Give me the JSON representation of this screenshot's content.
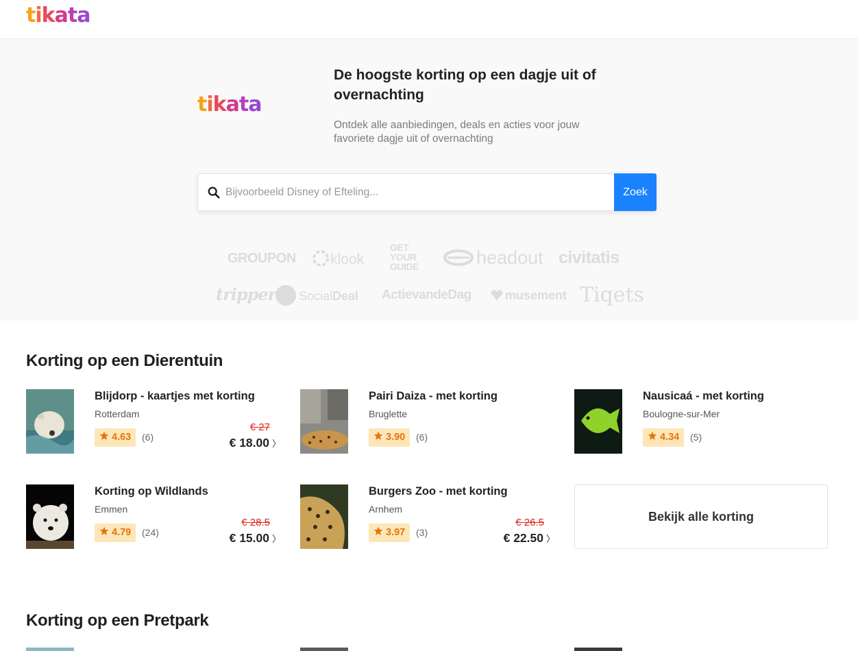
{
  "header": {
    "logo_letters": [
      "t",
      "i",
      "k",
      "a",
      "t",
      "a"
    ]
  },
  "hero": {
    "logo_letters": [
      "t",
      "i",
      "k",
      "a",
      "t",
      "a"
    ],
    "title": "De hoogste korting op een dagje uit of overnachting",
    "subtitle": "Ontdek alle aanbiedingen, deals en acties voor jouw favoriete dagje uit of overnachting",
    "search": {
      "placeholder": "Bijvoorbeeld Disney of Efteling...",
      "value": "",
      "button_label": "Zoek"
    },
    "partners": {
      "groupon": "GROUPON",
      "klook": "klook",
      "getyourguide": [
        "GET",
        "YOUR",
        "GUIDE"
      ],
      "headout": "headout",
      "civitatis": "civitatis",
      "tripper": "tripper",
      "socialdeal_a": "Social",
      "socialdeal_b": "Deal",
      "actievandedag": "ActievandeDag",
      "musement": "musement",
      "tiqets": "Tiqets"
    }
  },
  "sections": [
    {
      "title": "Korting op een Dierentuin",
      "cards": [
        {
          "title": "Blijdorp - kaartjes met korting",
          "city": "Rotterdam",
          "rating": "4.63",
          "reviews": "(6)",
          "old_price": "€ 27",
          "price": "€ 18.00",
          "chevron": "〉"
        },
        {
          "title": "Pairi Daiza - met korting",
          "city": "Bruglette",
          "rating": "3.90",
          "reviews": "(6)",
          "old_price": "",
          "price": "",
          "chevron": ""
        },
        {
          "title": "Nausicaá - met korting",
          "city": "Boulogne-sur-Mer",
          "rating": "4.34",
          "reviews": "(5)",
          "old_price": "",
          "price": "",
          "chevron": ""
        },
        {
          "title": "Korting op Wildlands",
          "city": "Emmen",
          "rating": "4.79",
          "reviews": "(24)",
          "old_price": "€ 28.5",
          "price": "€ 15.00",
          "chevron": "〉"
        },
        {
          "title": "Burgers Zoo - met korting",
          "city": "Arnhem",
          "rating": "3.97",
          "reviews": "(3)",
          "old_price": "€ 26.5",
          "price": "€ 22.50",
          "chevron": "〉"
        }
      ],
      "view_all": "Bekijk alle korting"
    },
    {
      "title": "Korting op een Pretpark"
    }
  ],
  "colors": {
    "accent": "#1a82ff",
    "rating_bg": "#fde7b8",
    "rating_text": "#e8730c",
    "old_price": "#e2231a",
    "logo_gradient": [
      "#f7a21b",
      "#f26a3d",
      "#e8485d",
      "#d23c8a",
      "#b441b7",
      "#9a48d0"
    ]
  },
  "icons": {
    "search": "magnifier-icon",
    "rating": "star-icon",
    "price": "chevron-right-icon"
  }
}
